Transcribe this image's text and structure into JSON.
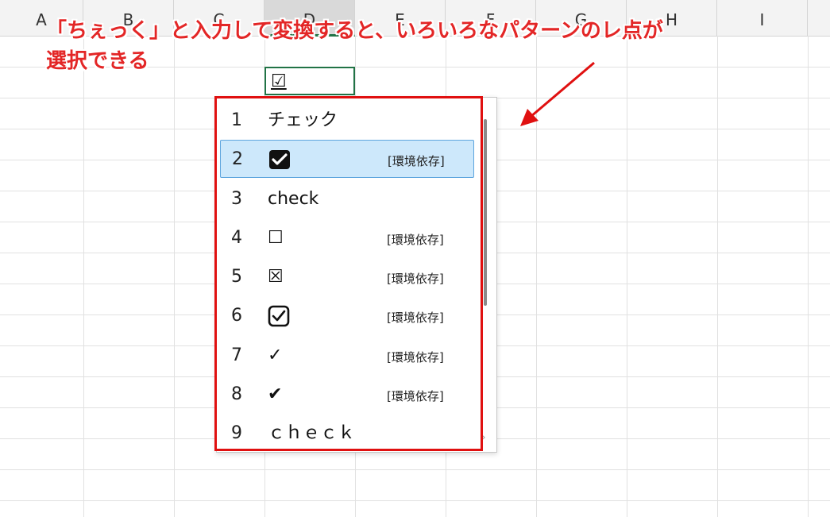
{
  "columns": [
    "A",
    "B",
    "C",
    "D",
    "E",
    "F",
    "G",
    "H",
    "I"
  ],
  "active_cell": {
    "value": "☑"
  },
  "annotation": {
    "line1": "「ちぇっく」と入力して変換すると、いろいろなパターンのレ点が",
    "line2": "選択できる",
    "color": "#e32626"
  },
  "candidates": [
    {
      "num": "1",
      "text": "チェック",
      "note": "",
      "icon": ""
    },
    {
      "num": "2",
      "text": "",
      "note": "[環境依存]",
      "icon": "filled-checkbox-icon",
      "selected": true
    },
    {
      "num": "3",
      "text": "check",
      "note": "",
      "icon": ""
    },
    {
      "num": "4",
      "text": "☐",
      "note": "[環境依存]",
      "icon": ""
    },
    {
      "num": "5",
      "text": "☒",
      "note": "[環境依存]",
      "icon": ""
    },
    {
      "num": "6",
      "text": "",
      "note": "[環境依存]",
      "icon": "outlined-checkbox-icon"
    },
    {
      "num": "7",
      "text": "✓",
      "note": "[環境依存]",
      "icon": ""
    },
    {
      "num": "8",
      "text": "✔",
      "note": "[環境依存]",
      "icon": ""
    },
    {
      "num": "9",
      "text": "ｃｈｅｃｋ",
      "note": "",
      "icon": ""
    }
  ],
  "colors": {
    "selected_bg": "#cde8fb",
    "highlight_border": "#e01010",
    "active_cell_border": "#217346"
  }
}
